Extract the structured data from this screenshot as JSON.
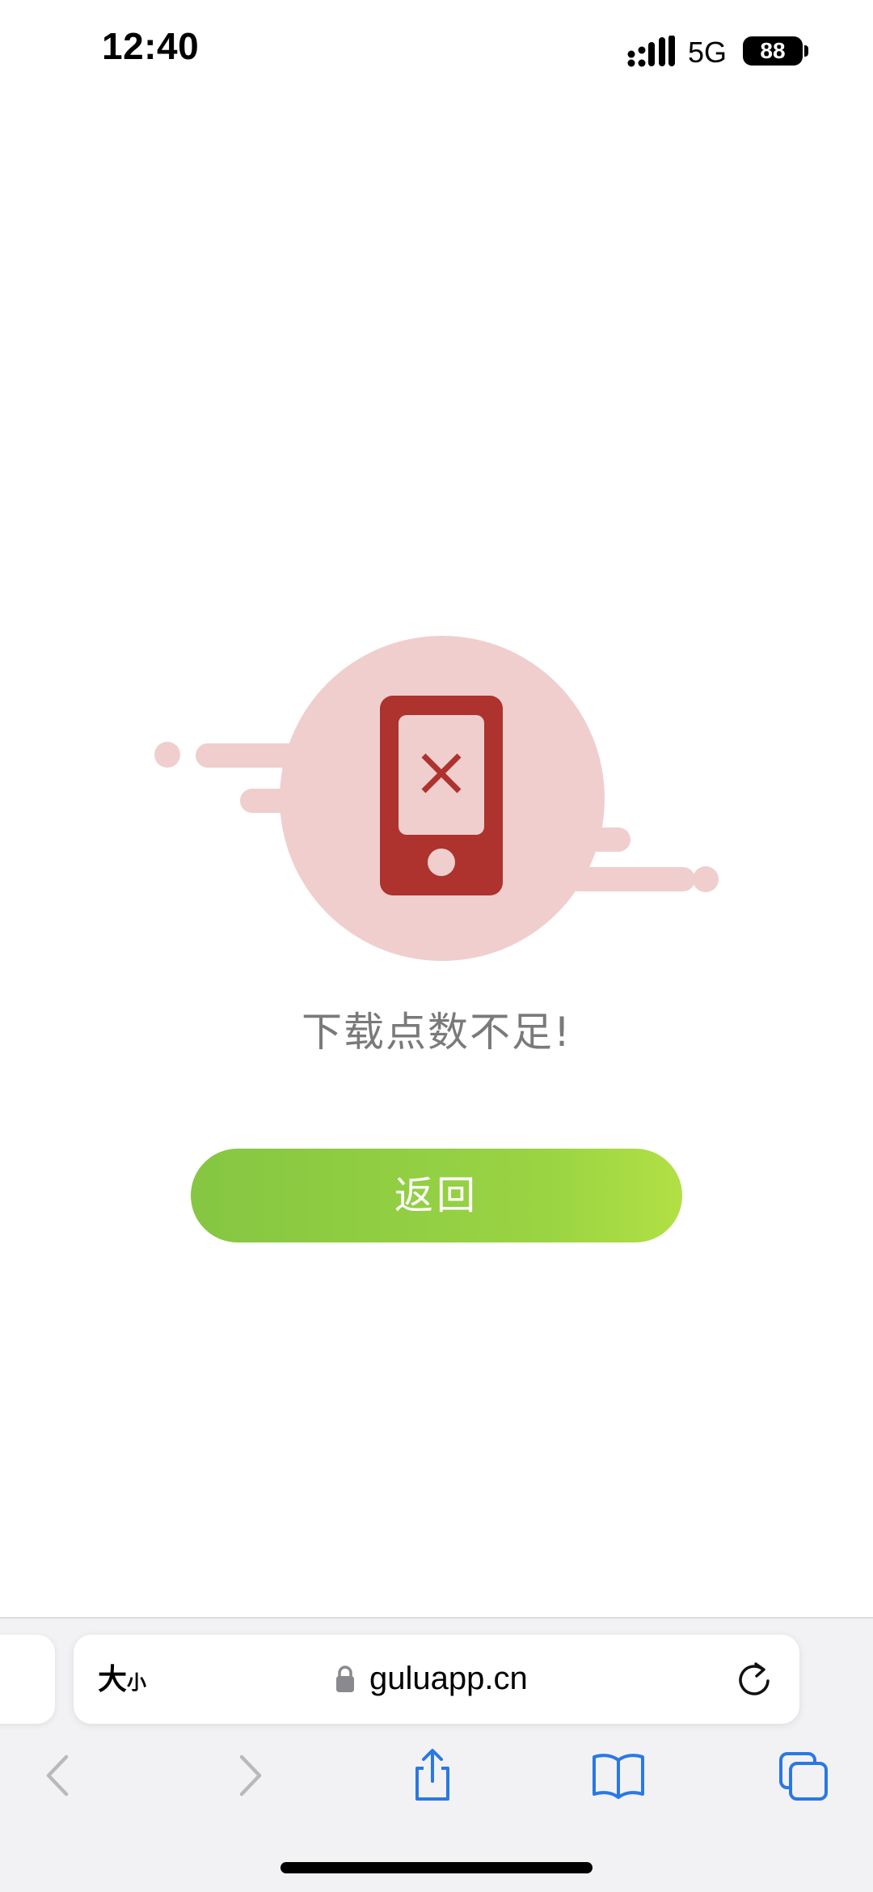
{
  "status_bar": {
    "time": "12:40",
    "network": "5G",
    "battery": "88"
  },
  "main": {
    "message": "下载点数不足!",
    "back_button_label": "返回"
  },
  "browser": {
    "text_size_big": "大",
    "text_size_small": "小",
    "url": "guluapp.cn"
  },
  "colors": {
    "illustration_circle": "#f0cece",
    "phone_red": "#ae322d",
    "button_gradient_start": "#85c642",
    "button_gradient_end": "#b1e044",
    "toolbar_icon_blue": "#2a78e4"
  },
  "icons": {
    "signal": "signal-bars-icon",
    "lock": "lock-icon",
    "reload": "reload-icon",
    "back": "chevron-left-icon",
    "forward": "chevron-right-icon",
    "share": "share-icon",
    "bookmarks": "book-icon",
    "tabs": "tabs-icon"
  }
}
